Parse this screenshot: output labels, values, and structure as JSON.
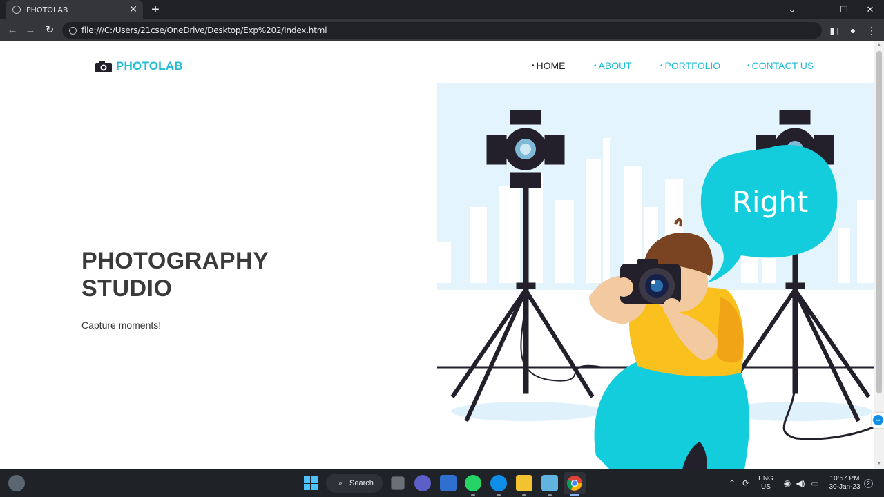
{
  "browser": {
    "tab_title": "PHOTOLAB",
    "tab_close": "✕",
    "new_tab": "+",
    "url": "file:///C:/Users/21cse/OneDrive/Desktop/Exp%202/Index.html",
    "window_controls": {
      "chevron": "⌄",
      "minimize": "—",
      "maximize": "☐",
      "close": "✕"
    },
    "nav_icons": {
      "back": "←",
      "forward": "→",
      "reload": "↻"
    },
    "toolbar_icons": {
      "sidepanel": "◧",
      "profile": "●",
      "menu": "⋮"
    }
  },
  "page": {
    "logo_text": "PHOTOLAB",
    "nav": [
      {
        "dot": "•",
        "label": "HOME",
        "active": true
      },
      {
        "dot": "•",
        "label": "ABOUT",
        "active": false
      },
      {
        "dot": "•",
        "label": "PORTFOLIO",
        "active": false
      },
      {
        "dot": "•",
        "label": "CONTACT US",
        "active": false
      }
    ],
    "hero": {
      "title_line1": "PHOTOGRAPHY",
      "title_line2": "STUDIO",
      "subtitle": "Capture moments!"
    },
    "illustration": {
      "speech_bubble_text": "Right",
      "colors": {
        "sky": "#e3f4fc",
        "accent": "#13cddd",
        "shirt": "#f9c01e",
        "skin": "#f3c9a0",
        "hair": "#7a4321",
        "equipment": "#231f2b"
      }
    }
  },
  "taskbar": {
    "search_label": "Search",
    "search_icon": "⌕",
    "language_line1": "ENG",
    "language_line2": "US",
    "time": "10:57 PM",
    "date": "30-Jan-23",
    "notification_count": "2",
    "tray_icons": {
      "chevron_up": "⌃",
      "wifi": "◉",
      "volume": "◀)",
      "battery": "▭"
    }
  }
}
